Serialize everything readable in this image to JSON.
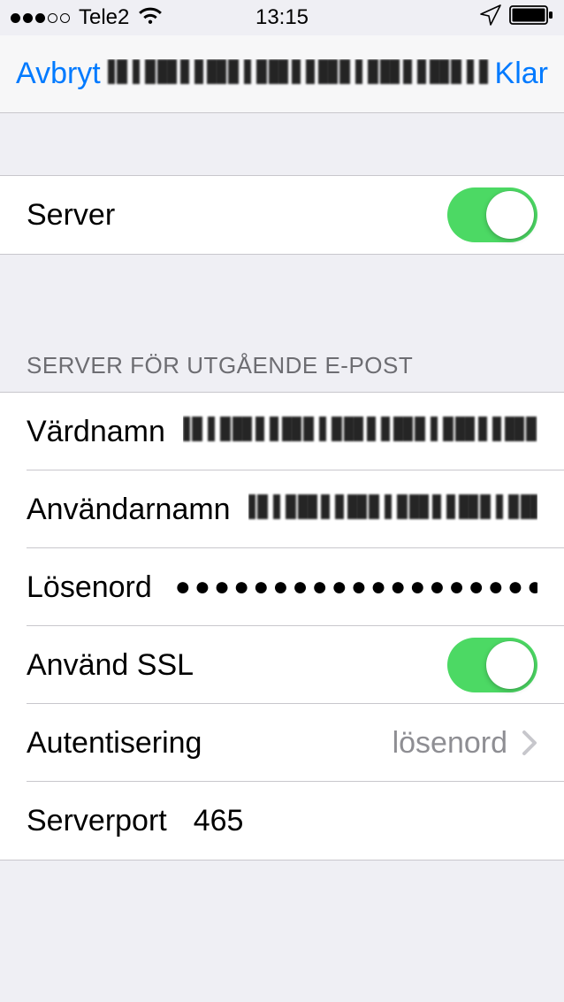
{
  "statusbar": {
    "carrier": "Tele2",
    "time": "13:15"
  },
  "nav": {
    "cancel": "Avbryt",
    "done": "Klar",
    "title_censored": true
  },
  "group_server": {
    "label": "Server",
    "toggle_on": true
  },
  "group_outgoing": {
    "header": "SERVER FÖR UTGÅENDE E-POST",
    "hostname_label": "Värdnamn",
    "username_label": "Användarnamn",
    "password_label": "Lösenord",
    "password_value": "●●●●●●●●●●●●●●●●●●●●...",
    "use_ssl_label": "Använd SSL",
    "use_ssl_on": true,
    "auth_label": "Autentisering",
    "auth_value": "lösenord",
    "port_label": "Serverport",
    "port_value": "465"
  }
}
